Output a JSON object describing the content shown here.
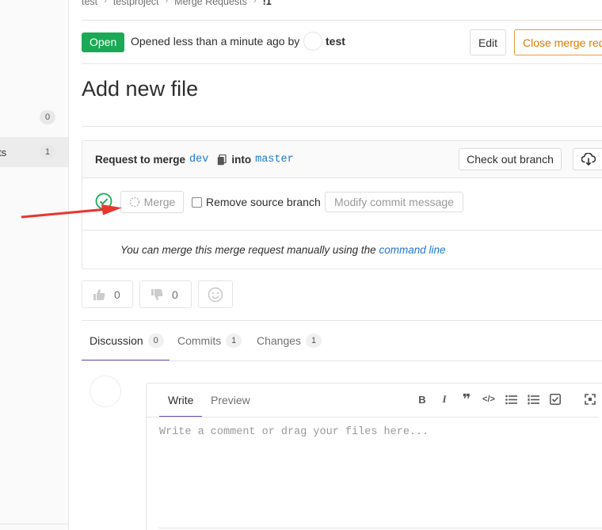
{
  "sidebar": {
    "items": [
      {
        "label": "",
        "count": "0"
      },
      {
        "label": "ts",
        "count": "1"
      }
    ]
  },
  "breadcrumb": [
    "test",
    "testproject",
    "Merge Requests",
    "!1"
  ],
  "header": {
    "status": "Open",
    "opened_text": "Opened less than a minute ago by",
    "author": "test",
    "edit_label": "Edit",
    "close_label": "Close merge request"
  },
  "mr_title": "Add new file",
  "widget": {
    "request_prefix": "Request to merge",
    "source_branch": "dev",
    "into_text": "into",
    "target_branch": "master",
    "checkout_label": "Check out branch",
    "merge_label": "Merge",
    "remove_source_label": "Remove source branch",
    "modify_commit_label": "Modify commit message",
    "manual_text": "You can merge this merge request manually using the",
    "command_line_link": "command line"
  },
  "awards": {
    "thumbsup_count": "0",
    "thumbsdown_count": "0"
  },
  "tabs": [
    {
      "label": "Discussion",
      "count": "0"
    },
    {
      "label": "Commits",
      "count": "1"
    },
    {
      "label": "Changes",
      "count": "1"
    }
  ],
  "comment": {
    "write_tab": "Write",
    "preview_tab": "Preview",
    "placeholder": "Write a comment or drag your files here...",
    "toolbar": [
      "bold-icon",
      "italic-icon",
      "quote-icon",
      "code-icon",
      "bullet-list-icon",
      "numbered-list-icon",
      "task-list-icon",
      "fullscreen-icon"
    ]
  },
  "colors": {
    "status_green": "#1aaa55",
    "link_blue": "#1f78d1",
    "active_tab": "#6b4fbb",
    "close_orange": "#e07a00",
    "annotation_red": "#e8372e"
  }
}
